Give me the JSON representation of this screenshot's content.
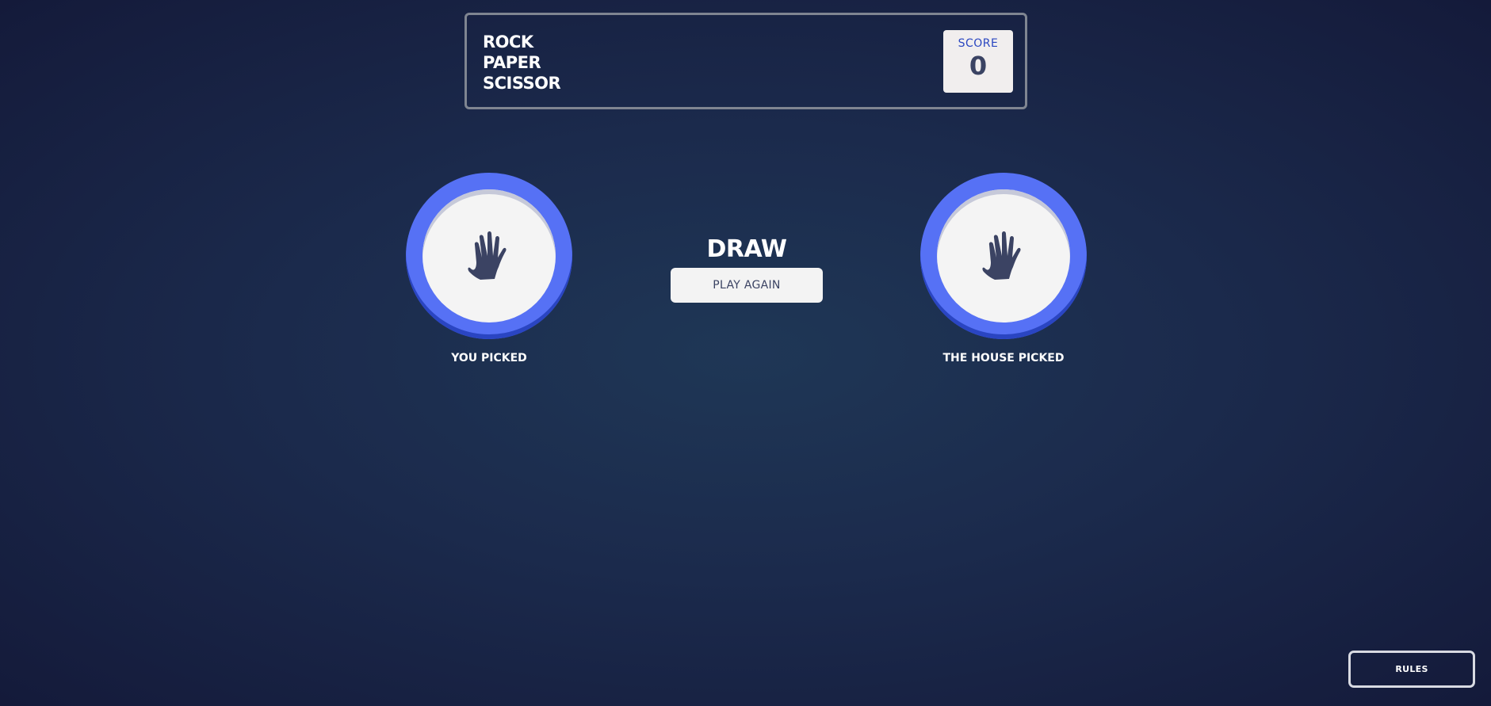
{
  "header": {
    "title_lines": [
      "ROCK",
      "PAPER",
      "SCISSOR"
    ],
    "score_label": "SCORE",
    "score_value": "0"
  },
  "player": {
    "label": "YOU PICKED",
    "choice_icon": "paper-hand-icon"
  },
  "house": {
    "label": "THE HOUSE PICKED",
    "choice_icon": "paper-hand-icon"
  },
  "result": {
    "text": "DRAW",
    "play_again_label": "PLAY AGAIN"
  },
  "rules_button": {
    "label": "RULES"
  },
  "colors": {
    "paper_ring": "#5671f5",
    "paper_ring_shadow": "#2a45c2",
    "score_label": "#2a46c0",
    "dark_text": "#3b4363",
    "background": "#1b2a4c"
  }
}
